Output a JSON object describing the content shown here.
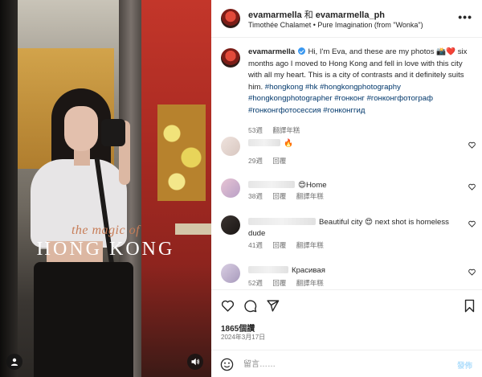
{
  "photo": {
    "overlay_subtitle": "the magic of",
    "overlay_title": "HONG KONG",
    "tag_icon": "person-tag-icon",
    "audio_icon": "audio-icon"
  },
  "header": {
    "author": "evamarmella",
    "joiner": "和",
    "collaborator": "evamarmella_ph",
    "music": "Timothée Chalamet • Pure Imagination (from \"Wonka\")",
    "more_icon": "•••"
  },
  "caption": {
    "user": "evamarmella",
    "text": "Hi, I'm Eva, and these are my photos 📸❤️ six months ago I moved to Hong Kong and fell in love with this city with all my heart. This is a city of contrasts and it definitely suits him.",
    "hashtags": "#hongkong #hk #hongkongphotography #hongkongphotographer #гонконг #гонконгфотограф #гонконгфотосессия #гонконггид",
    "age": "53週",
    "translate": "翻譯年糕"
  },
  "comments": [
    {
      "text": "🔥",
      "age": "29週",
      "reply": "回覆",
      "translate": "",
      "avatar_color": "#e6d9d4"
    },
    {
      "text": "😍Home",
      "age": "38週",
      "reply": "回覆",
      "translate": "翻譯年糕",
      "avatar_color": "#d9b3c4"
    },
    {
      "text": "Beautiful city 😍 next shot is homeless dude",
      "age": "41週",
      "reply": "回覆",
      "translate": "翻譯年糕",
      "avatar_color": "#2b2725"
    },
    {
      "text": "Красивая",
      "age": "52週",
      "reply": "回覆",
      "translate": "翻譯年糕",
      "avatar_color": "#c9bcd4"
    }
  ],
  "stats": {
    "likes": "1865個讚",
    "date": "2024年3月17日"
  },
  "composer": {
    "placeholder": "留言……",
    "post_label": "發佈"
  },
  "colors": {
    "link": "#00376b",
    "meta": "#737373",
    "post_disabled": "#b2dffc",
    "verified": "#3897f0"
  }
}
